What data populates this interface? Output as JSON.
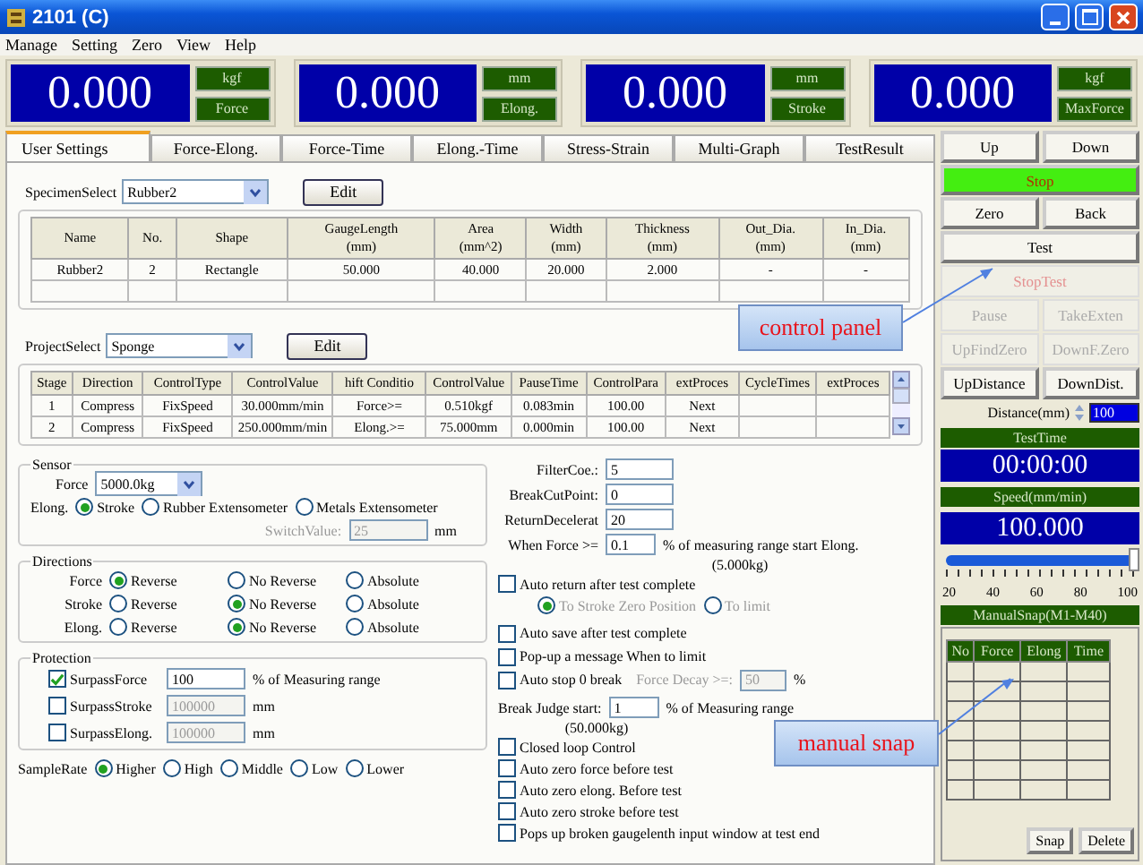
{
  "window": {
    "title": "2101 (C)"
  },
  "menu": [
    "Manage",
    "Setting",
    "Zero",
    "View",
    "Help"
  ],
  "displays": [
    {
      "value": "0.000",
      "unit": "kgf",
      "quantity": "Force"
    },
    {
      "value": "0.000",
      "unit": "mm",
      "quantity": "Elong."
    },
    {
      "value": "0.000",
      "unit": "mm",
      "quantity": "Stroke"
    },
    {
      "value": "0.000",
      "unit": "kgf",
      "quantity": "MaxForce"
    }
  ],
  "tabs": [
    {
      "label": "User Settings",
      "selected": true
    },
    {
      "label": "Force-Elong.",
      "selected": false
    },
    {
      "label": "Force-Time",
      "selected": false
    },
    {
      "label": "Elong.-Time",
      "selected": false
    },
    {
      "label": "Stress-Strain",
      "selected": false
    },
    {
      "label": "Multi-Graph",
      "selected": false
    },
    {
      "label": "TestResult",
      "selected": false
    }
  ],
  "specimen": {
    "label": "SpecimenSelect",
    "value": "Rubber2",
    "edit": "Edit",
    "columns": [
      {
        "label": "Name"
      },
      {
        "label": "No."
      },
      {
        "label": "Shape"
      },
      {
        "label": "GaugeLength",
        "unit": "(mm)"
      },
      {
        "label": "Area",
        "unit": "(mm^2)"
      },
      {
        "label": "Width",
        "unit": "(mm)"
      },
      {
        "label": "Thickness",
        "unit": "(mm)"
      },
      {
        "label": "Out_Dia.",
        "unit": "(mm)"
      },
      {
        "label": "In_Dia.",
        "unit": "(mm)"
      }
    ],
    "rows": [
      [
        "Rubber2",
        "2",
        "Rectangle",
        "50.000",
        "40.000",
        "20.000",
        "2.000",
        "-",
        "-"
      ]
    ]
  },
  "project": {
    "label": "ProjectSelect",
    "value": "Sponge",
    "edit": "Edit",
    "columns": [
      "Stage",
      "Direction",
      "ControlType",
      "ControlValue",
      "hift Conditio",
      "ControlValue",
      "PauseTime",
      "ControlPara",
      "extProces",
      "CycleTimes",
      "extProces"
    ],
    "rows": [
      [
        "1",
        "Compress",
        "FixSpeed",
        "30.000mm/min",
        "Force>=",
        "0.510kgf",
        "0.083min",
        "100.00",
        "Next"
      ],
      [
        "2",
        "Compress",
        "FixSpeed",
        "250.000mm/min",
        "Elong.>=",
        "75.000mm",
        "0.000min",
        "100.00",
        "Next"
      ]
    ]
  },
  "sensor": {
    "title": "Sensor",
    "force_label": "Force",
    "force_value": "5000.0kg",
    "elong_label": "Elong.",
    "elong_options": [
      {
        "label": "Stroke",
        "selected": true
      },
      {
        "label": "Rubber Extensometer",
        "selected": false
      },
      {
        "label": "Metals Extensometer",
        "selected": false
      }
    ],
    "switch_label": "SwitchValue:",
    "switch_value": "25",
    "switch_unit": "mm"
  },
  "directions": {
    "title": "Directions",
    "rows": [
      {
        "label": "Force",
        "options": [
          {
            "label": "Reverse",
            "selected": true
          },
          {
            "label": "No Reverse",
            "selected": false
          },
          {
            "label": "Absolute",
            "selected": false
          }
        ]
      },
      {
        "label": "Stroke",
        "options": [
          {
            "label": "Reverse",
            "selected": false
          },
          {
            "label": "No Reverse",
            "selected": true
          },
          {
            "label": "Absolute",
            "selected": false
          }
        ]
      },
      {
        "label": "Elong.",
        "options": [
          {
            "label": "Reverse",
            "selected": false
          },
          {
            "label": "No Reverse",
            "selected": true
          },
          {
            "label": "Absolute",
            "selected": false
          }
        ]
      }
    ]
  },
  "protection": {
    "title": "Protection",
    "rows": [
      {
        "label": "SurpassForce",
        "checked": true,
        "value": "100",
        "unit": "% of Measuring range"
      },
      {
        "label": "SurpassStroke",
        "checked": false,
        "value": "100000",
        "unit": "mm"
      },
      {
        "label": "SurpassElong.",
        "checked": false,
        "value": "100000",
        "unit": "mm"
      }
    ]
  },
  "sample_rate": {
    "label": "SampleRate",
    "options": [
      {
        "label": "Higher",
        "selected": true
      },
      {
        "label": "High",
        "selected": false
      },
      {
        "label": "Middle",
        "selected": false
      },
      {
        "label": "Low",
        "selected": false
      },
      {
        "label": "Lower",
        "selected": false
      }
    ]
  },
  "fields": [
    {
      "label": "FilterCoe.:",
      "value": "5"
    },
    {
      "label": "BreakCutPoint:",
      "value": "0"
    },
    {
      "label": "ReturnDecelerat",
      "value": "20"
    }
  ],
  "force_start": {
    "label": "When Force >=",
    "value": "0.1",
    "suffix": "% of measuring range start Elong.",
    "note": "(5.000kg)"
  },
  "auto_return": {
    "label": "Auto return after test complete",
    "checked": false,
    "options": [
      {
        "label": "To Stroke Zero Position",
        "selected": true
      },
      {
        "label": "To limit",
        "selected": false
      }
    ]
  },
  "checks_a": [
    {
      "label": "Auto save after test complete",
      "checked": false
    },
    {
      "label": "Pop-up a message When to limit",
      "checked": false
    }
  ],
  "auto_stop": {
    "label": "Auto stop 0 break",
    "checked": false,
    "decay_label": "Force Decay >=:",
    "decay_value": "50",
    "decay_unit": "%"
  },
  "break_judge": {
    "label": "Break Judge start:",
    "value": "1",
    "suffix": "% of Measuring range",
    "note": "(50.000kg)"
  },
  "checks_b": [
    {
      "label": "Closed loop Control",
      "checked": false
    },
    {
      "label": "Auto zero force before test",
      "checked": false
    },
    {
      "label": "Auto zero elong. Before test",
      "checked": false
    },
    {
      "label": "Auto zero stroke before test",
      "checked": false
    },
    {
      "label": "Pops up broken gaugelenth input window at test end",
      "checked": false
    }
  ],
  "control_rows": [
    [
      {
        "label": "Up",
        "kind": "normal",
        "disabled": false
      },
      {
        "label": "Down",
        "kind": "normal",
        "disabled": false
      }
    ],
    [
      {
        "label": "Stop",
        "kind": "stop",
        "disabled": false
      }
    ],
    [
      {
        "label": "Zero",
        "kind": "normal",
        "disabled": false
      },
      {
        "label": "Back",
        "kind": "normal",
        "disabled": false
      }
    ],
    [
      {
        "label": "Test",
        "kind": "normal",
        "disabled": false
      }
    ],
    [
      {
        "label": "StopTest",
        "kind": "alert",
        "disabled": true
      }
    ],
    [
      {
        "label": "Pause",
        "kind": "normal",
        "disabled": true
      },
      {
        "label": "TakeExten",
        "kind": "normal",
        "disabled": true
      }
    ],
    [
      {
        "label": "UpFindZero",
        "kind": "normal",
        "disabled": true
      },
      {
        "label": "DownF.Zero",
        "kind": "normal",
        "disabled": true
      }
    ],
    [
      {
        "label": "UpDistance",
        "kind": "normal",
        "disabled": false
      },
      {
        "label": "DownDist.",
        "kind": "normal",
        "disabled": false
      }
    ]
  ],
  "distance": {
    "label": "Distance(mm)",
    "value": "100"
  },
  "test_time": {
    "label": "TestTime",
    "value": "00:00:00"
  },
  "speed": {
    "label": "Speed(mm/min)",
    "value": "100.000",
    "level": 1.0,
    "ticks": [
      "20",
      "40",
      "60",
      "80",
      "100"
    ]
  },
  "manual_snap": {
    "title": "ManualSnap(M1-M40)",
    "columns": [
      "No",
      "Force",
      "Elong",
      "Time"
    ],
    "buttons": [
      "Snap",
      "Delete"
    ]
  },
  "annotations": [
    {
      "text": "control panel"
    },
    {
      "text": "manual snap"
    }
  ]
}
